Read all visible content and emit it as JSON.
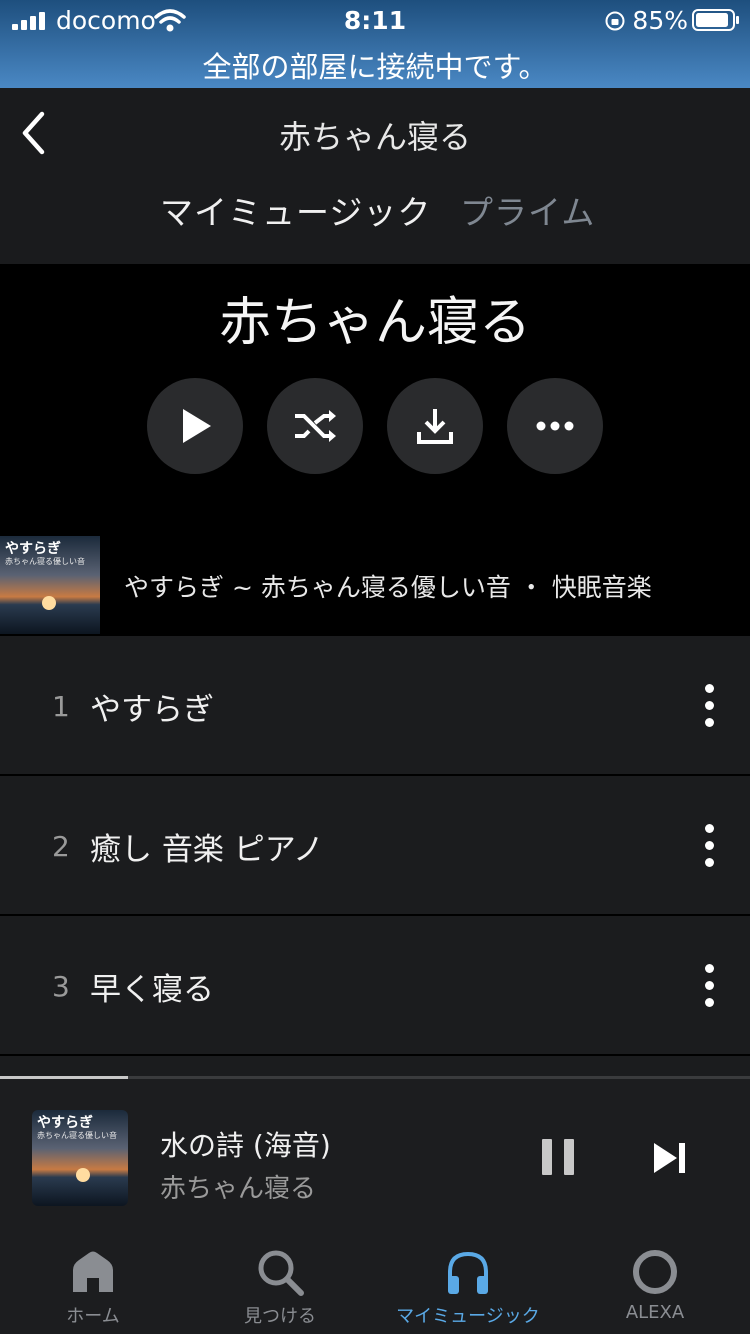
{
  "status_bar": {
    "carrier": "docomo",
    "time": "8:11",
    "battery_percent": "85%",
    "banner": "全部の部屋に接続中です。"
  },
  "nav": {
    "title": "赤ちゃん寝る",
    "tabs": [
      {
        "label": "マイミュージック",
        "active": true
      },
      {
        "label": "プライム",
        "active": false
      }
    ]
  },
  "playlist": {
    "title": "赤ちゃん寝る",
    "actions": [
      "play-icon",
      "shuffle-icon",
      "download-icon",
      "more-icon"
    ]
  },
  "album": {
    "art_title": "やすらぎ",
    "art_subtitle": "赤ちゃん寝る優しい音",
    "info": "やすらぎ ~ 赤ちゃん寝る優しい音 ・ 快眠音楽"
  },
  "tracks": [
    {
      "number": "1",
      "title": "やすらぎ"
    },
    {
      "number": "2",
      "title": "癒し 音楽 ピアノ"
    },
    {
      "number": "3",
      "title": "早く寝る"
    }
  ],
  "now_playing": {
    "song": "水の詩 (海音)",
    "artist": "赤ちゃん寝る",
    "art_title": "やすらぎ",
    "art_subtitle": "赤ちゃん寝る優しい音",
    "progress": 0.17
  },
  "tabbar": {
    "items": [
      {
        "label": "ホーム",
        "icon": "home-icon"
      },
      {
        "label": "見つける",
        "icon": "search-icon"
      },
      {
        "label": "マイミュージック",
        "icon": "headphones-icon",
        "active": true
      },
      {
        "label": "ALEXA",
        "icon": "alexa-icon"
      }
    ]
  },
  "colors": {
    "accent": "#5aa9e6",
    "background": "#000000",
    "surface": "#1b1c1e"
  }
}
